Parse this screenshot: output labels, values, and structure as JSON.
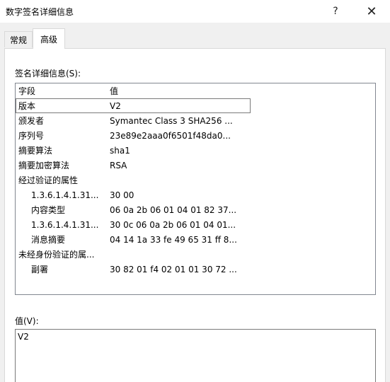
{
  "window": {
    "title": "数字签名详细信息",
    "help_label": "?",
    "close_label": "✕"
  },
  "tabs": [
    {
      "label": "常规",
      "active": false
    },
    {
      "label": "高级",
      "active": true
    }
  ],
  "details": {
    "group_label": "签名详细信息(S):",
    "columns": {
      "field": "字段",
      "value": "值"
    },
    "rows": [
      {
        "field": "版本",
        "value": "V2",
        "indent": false,
        "selected": true
      },
      {
        "field": "颁发者",
        "value": "Symantec Class 3 SHA256 ...",
        "indent": false,
        "selected": false
      },
      {
        "field": "序列号",
        "value": "23e89e2aaa0f6501f48da0...",
        "indent": false,
        "selected": false
      },
      {
        "field": "摘要算法",
        "value": "sha1",
        "indent": false,
        "selected": false
      },
      {
        "field": "摘要加密算法",
        "value": "RSA",
        "indent": false,
        "selected": false
      },
      {
        "field": "经过验证的属性",
        "value": "",
        "indent": false,
        "selected": false
      },
      {
        "field": "1.3.6.1.4.1.31...",
        "value": "30 00",
        "indent": true,
        "selected": false
      },
      {
        "field": "内容类型",
        "value": "06 0a 2b 06 01 04 01 82 37...",
        "indent": true,
        "selected": false
      },
      {
        "field": "1.3.6.1.4.1.31...",
        "value": "30 0c 06 0a 2b 06 01 04 01...",
        "indent": true,
        "selected": false
      },
      {
        "field": "消息摘要",
        "value": "04 14 1a 33 fe 49 65 31 ff 8...",
        "indent": true,
        "selected": false
      },
      {
        "field": "未经身份验证的属...",
        "value": "",
        "indent": false,
        "selected": false
      },
      {
        "field": "副署",
        "value": "30 82 01 f4 02 01 01 30 72 ...",
        "indent": true,
        "selected": false
      }
    ]
  },
  "value_section": {
    "label": "值(V):",
    "content": "V2"
  }
}
